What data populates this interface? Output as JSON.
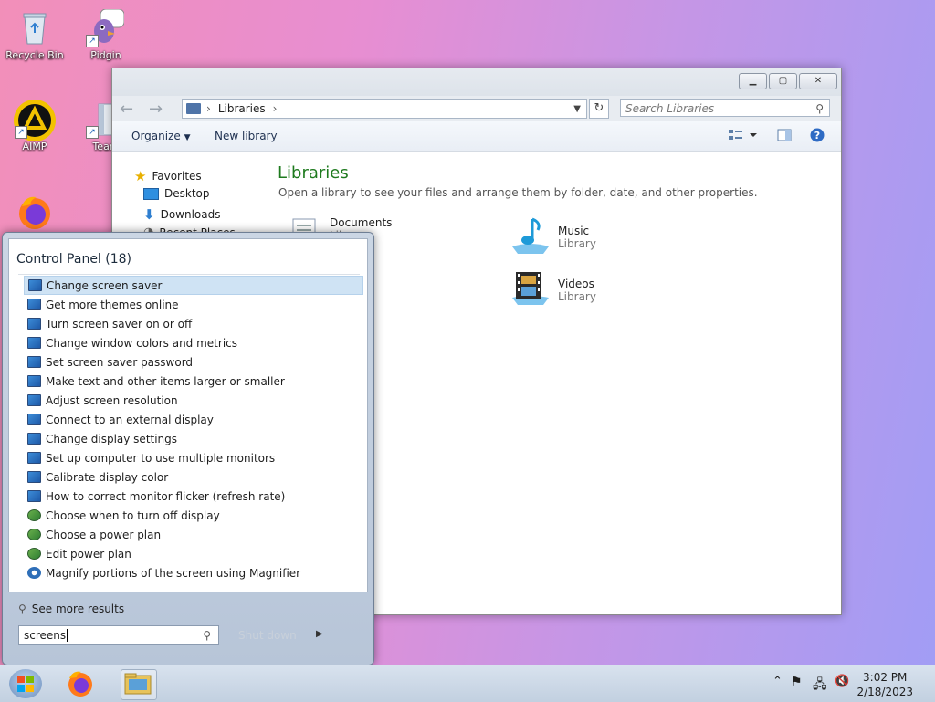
{
  "desktop": {
    "icons": [
      {
        "label": "Recycle Bin"
      },
      {
        "label": "Pidgin"
      },
      {
        "label": "AIMP"
      },
      {
        "label": "Team"
      }
    ]
  },
  "explorer": {
    "address": {
      "root": "Libraries",
      "sep": "›"
    },
    "search_placeholder": "Search Libraries",
    "toolbar": {
      "organize": "Organize",
      "new_library": "New library"
    },
    "nav": {
      "favorites": "Favorites",
      "desktop": "Desktop",
      "downloads": "Downloads",
      "recent": "Recent Places"
    },
    "heading": "Libraries",
    "subheading": "Open a library to see your files and arrange them by folder, date, and other properties.",
    "libraries": [
      {
        "name": "Documents",
        "sub": "Library"
      },
      {
        "name": "Music",
        "sub": "Library"
      },
      {
        "name": "Videos",
        "sub": "Library"
      }
    ]
  },
  "start_menu": {
    "section_title": "Control Panel (18)",
    "items": [
      {
        "label": "Change screen saver",
        "icon": "display"
      },
      {
        "label": "Get more themes online",
        "icon": "display"
      },
      {
        "label": "Turn screen saver on or off",
        "icon": "display"
      },
      {
        "label": "Change window colors and metrics",
        "icon": "display"
      },
      {
        "label": "Set screen saver password",
        "icon": "display"
      },
      {
        "label": "Make text and other items larger or smaller",
        "icon": "display"
      },
      {
        "label": "Adjust screen resolution",
        "icon": "display"
      },
      {
        "label": "Connect to an external display",
        "icon": "display"
      },
      {
        "label": "Change display settings",
        "icon": "display"
      },
      {
        "label": "Set up computer to use multiple monitors",
        "icon": "display"
      },
      {
        "label": "Calibrate display color",
        "icon": "display"
      },
      {
        "label": "How to correct monitor flicker (refresh rate)",
        "icon": "display"
      },
      {
        "label": "Choose when to turn off display",
        "icon": "power"
      },
      {
        "label": "Choose a power plan",
        "icon": "power"
      },
      {
        "label": "Edit power plan",
        "icon": "power"
      },
      {
        "label": "Magnify portions of the screen using Magnifier",
        "icon": "magnifier"
      }
    ],
    "see_more": "See more results",
    "search_value": "screens",
    "shutdown_label": "Shut down"
  },
  "taskbar": {
    "time": "3:02 PM",
    "date": "2/18/2023"
  }
}
